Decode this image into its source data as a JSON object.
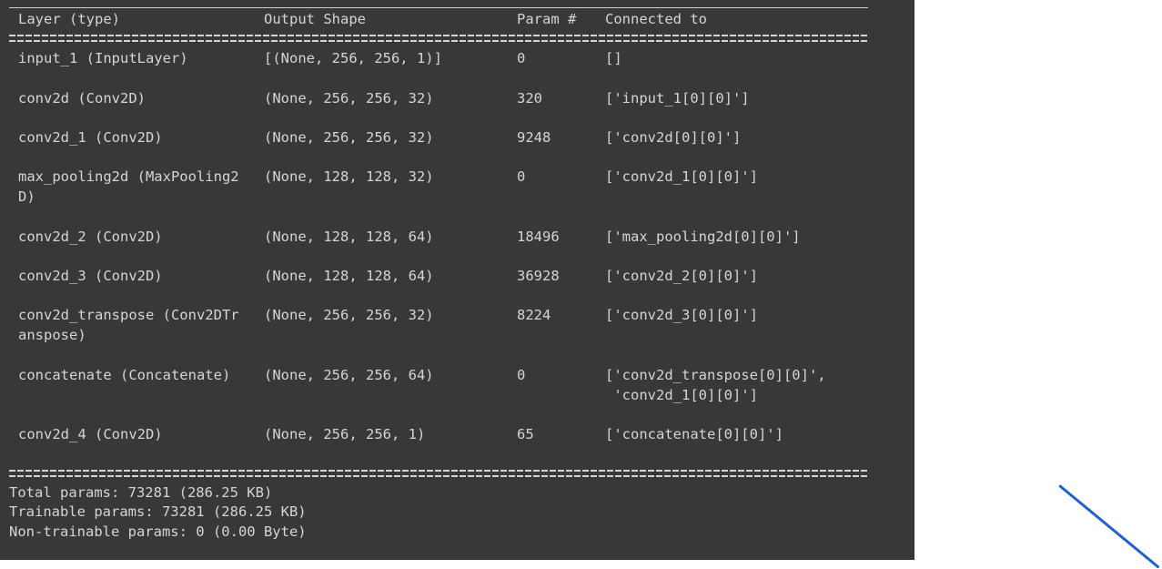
{
  "header": {
    "layer": "Layer (type)",
    "output_shape": "Output Shape",
    "params": "Param #",
    "connected": "Connected to"
  },
  "rows": [
    {
      "layer": "input_1 (InputLayer)",
      "shape": "[(None, 256, 256, 1)]",
      "params": "0",
      "connected": "[]"
    },
    {
      "layer": "conv2d (Conv2D)",
      "shape": "(None, 256, 256, 32)",
      "params": "320",
      "connected": "['input_1[0][0]']"
    },
    {
      "layer": "conv2d_1 (Conv2D)",
      "shape": "(None, 256, 256, 32)",
      "params": "9248",
      "connected": "['conv2d[0][0]']"
    },
    {
      "layer": "max_pooling2d (MaxPooling2\nD)",
      "shape": "(None, 128, 128, 32)",
      "params": "0",
      "connected": "['conv2d_1[0][0]']"
    },
    {
      "layer": "conv2d_2 (Conv2D)",
      "shape": "(None, 128, 128, 64)",
      "params": "18496",
      "connected": "['max_pooling2d[0][0]']"
    },
    {
      "layer": "conv2d_3 (Conv2D)",
      "shape": "(None, 128, 128, 64)",
      "params": "36928",
      "connected": "['conv2d_2[0][0]']"
    },
    {
      "layer": "conv2d_transpose (Conv2DTr\nanspose)",
      "shape": "(None, 256, 256, 32)",
      "params": "8224",
      "connected": "['conv2d_3[0][0]']"
    },
    {
      "layer": "concatenate (Concatenate)",
      "shape": "(None, 256, 256, 64)",
      "params": "0",
      "connected": "['conv2d_transpose[0][0]',\n 'conv2d_1[0][0]']"
    },
    {
      "layer": "conv2d_4 (Conv2D)",
      "shape": "(None, 256, 256, 1)",
      "params": "65",
      "connected": "['concatenate[0][0]']"
    }
  ],
  "summary": {
    "total": "Total params: 73281 (286.25 KB)",
    "trainable": "Trainable params: 73281 (286.25 KB)",
    "non_trainable": "Non-trainable params: 0 (0.00 Byte)"
  },
  "colors": {
    "console_bg": "#383838",
    "text": "#d5d5d5",
    "accent_line": "#1f5fd1"
  }
}
